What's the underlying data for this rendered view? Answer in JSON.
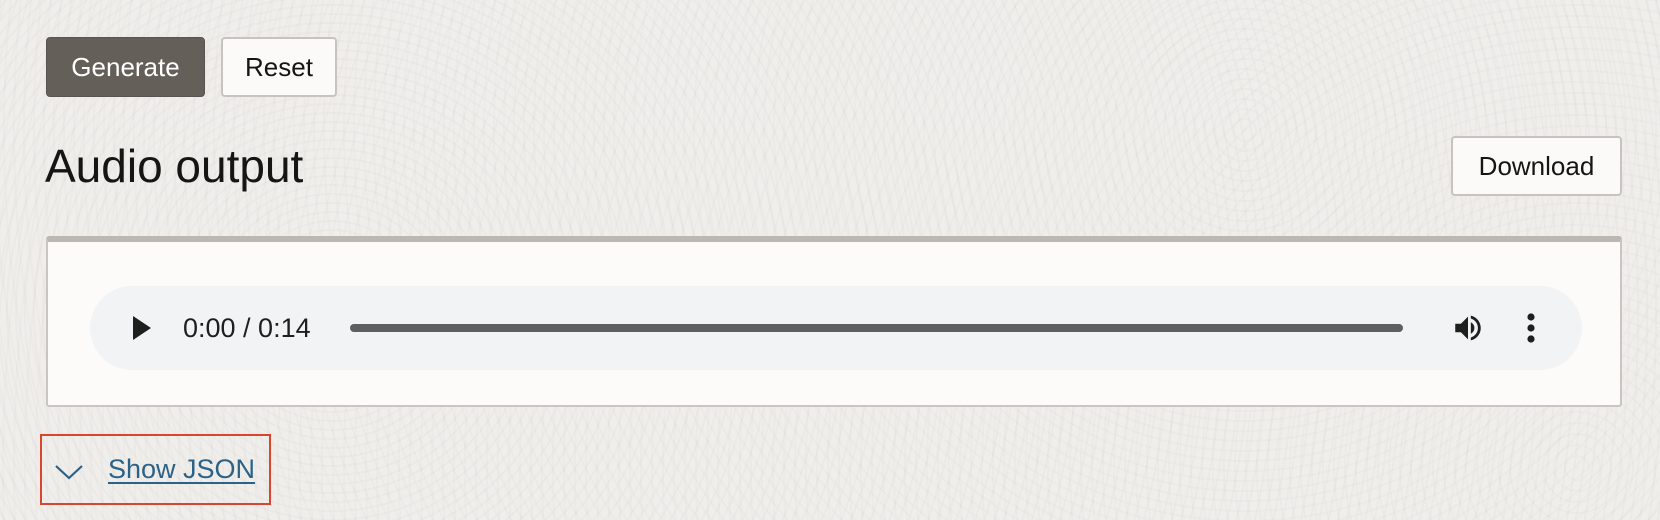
{
  "toolbar": {
    "generate_label": "Generate",
    "reset_label": "Reset"
  },
  "audio_output": {
    "title": "Audio output",
    "download_label": "Download",
    "player": {
      "time_text": "0:00 / 0:14",
      "progress": 0.0,
      "play_icon": "play-icon",
      "volume_icon": "volume-icon",
      "more_icon": "more-vertical-icon"
    }
  },
  "json_toggle": {
    "label": "Show JSON",
    "icon": "chevron-down-icon"
  },
  "colors": {
    "primary_button": "#655f5a",
    "link": "#2d6287",
    "focus_outline": "#d9452f",
    "player_background": "#f1f3f4"
  }
}
